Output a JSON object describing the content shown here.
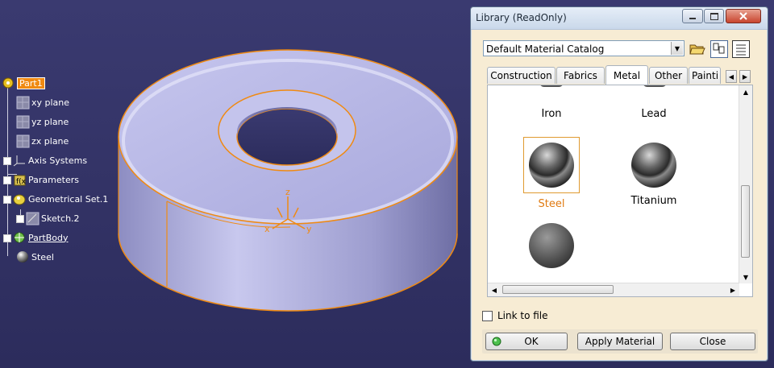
{
  "spec_tree": {
    "items": [
      {
        "label": "Part1",
        "icon": "part-icon"
      },
      {
        "label": "xy plane",
        "icon": "plane-icon"
      },
      {
        "label": "yz plane",
        "icon": "plane-icon"
      },
      {
        "label": "zx plane",
        "icon": "plane-icon"
      },
      {
        "label": "Axis Systems",
        "icon": "axis-system-icon"
      },
      {
        "label": "Parameters",
        "icon": "parameters-icon"
      },
      {
        "label": "Geometrical Set.1",
        "icon": "geometrical-set-icon"
      },
      {
        "label": "Sketch.2",
        "icon": "sketch-icon"
      },
      {
        "label": "PartBody",
        "icon": "partbody-icon"
      },
      {
        "label": "Steel",
        "icon": "material-sphere-icon"
      }
    ]
  },
  "compass": {
    "x": "x",
    "y": "y",
    "z": "z"
  },
  "colors": {
    "background": "#36366a",
    "selection_orange": "#f08a12",
    "part_surface": "#b3b3e2",
    "dialog_bg": "#f7ecd4"
  },
  "dialog": {
    "title": "Library (ReadOnly)",
    "catalog": "Default Material Catalog",
    "tabs": [
      "Construction",
      "Fabrics",
      "Metal",
      "Other",
      "Painti"
    ],
    "active_tab": "Metal",
    "materials": [
      {
        "name": "Iron",
        "selected": false
      },
      {
        "name": "Lead",
        "selected": false
      },
      {
        "name": "Steel",
        "selected": true
      },
      {
        "name": "Titanium",
        "selected": false
      },
      {
        "name": "",
        "selected": false
      }
    ],
    "link_to_file": "Link to file",
    "buttons": {
      "ok": "OK",
      "apply": "Apply Material",
      "close": "Close"
    }
  }
}
